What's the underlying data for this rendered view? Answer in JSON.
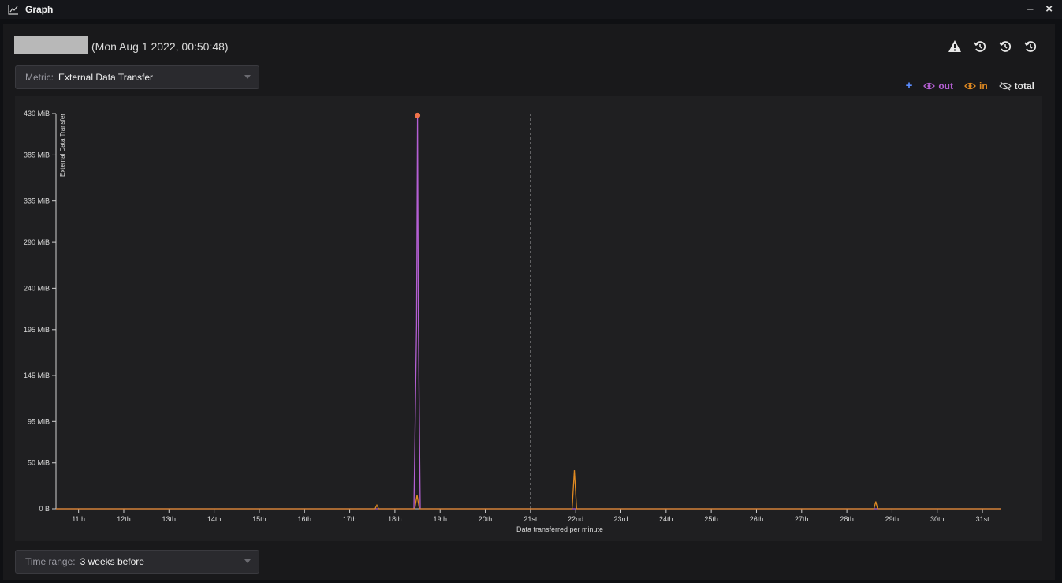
{
  "window": {
    "title": "Graph",
    "minimize_label": "–",
    "close_label": "×"
  },
  "header": {
    "timestamp": "(Mon Aug 1 2022, 00:50:48)"
  },
  "metric_select": {
    "label": "Metric:",
    "value": "External Data Transfer"
  },
  "time_range_select": {
    "label": "Time range:",
    "value": "3 weeks before"
  },
  "legend": {
    "add_label": "+",
    "items": [
      {
        "label": "out",
        "color": "#b45fd3",
        "icon": "eye-icon"
      },
      {
        "label": "in",
        "color": "#e08a22",
        "icon": "eye-icon"
      },
      {
        "label": "total",
        "color": "#e6e6e6",
        "icon": "eye-off-icon"
      }
    ]
  },
  "colors": {
    "out": "#b45fd3",
    "in": "#e08a22",
    "peak_marker": "#f0724a",
    "axis": "#cfcfcf"
  },
  "chart_data": {
    "type": "line",
    "xlabel": "Data transferred per minute",
    "ylabel": "External Data Transfer",
    "x_ticks": [
      "11th",
      "12th",
      "13th",
      "14th",
      "15th",
      "16th",
      "17th",
      "18th",
      "19th",
      "20th",
      "21st",
      "22nd",
      "23rd",
      "24th",
      "25th",
      "26th",
      "27th",
      "28th",
      "29th",
      "30th",
      "31st"
    ],
    "x_range": [
      10.5,
      31.4
    ],
    "y_ticks": [
      "0 B",
      "50 MiB",
      "95 MiB",
      "145 MiB",
      "195 MiB",
      "240 MiB",
      "290 MiB",
      "335 MiB",
      "385 MiB",
      "430 MiB"
    ],
    "y_tick_values": [
      0,
      50,
      95,
      145,
      195,
      240,
      290,
      335,
      385,
      430
    ],
    "ylim": [
      0,
      430
    ],
    "vline_x": 21.0,
    "series": [
      {
        "name": "out",
        "color": "#b45fd3",
        "points": [
          [
            10.5,
            0
          ],
          [
            18.42,
            0
          ],
          [
            18.48,
            200
          ],
          [
            18.5,
            428
          ],
          [
            18.52,
            200
          ],
          [
            18.56,
            0
          ],
          [
            31.4,
            0
          ]
        ]
      },
      {
        "name": "in",
        "color": "#e08a22",
        "points": [
          [
            10.5,
            0
          ],
          [
            17.56,
            0
          ],
          [
            17.6,
            4
          ],
          [
            17.64,
            0
          ],
          [
            18.44,
            0
          ],
          [
            18.49,
            15
          ],
          [
            18.54,
            0
          ],
          [
            21.92,
            0
          ],
          [
            21.97,
            42
          ],
          [
            22.02,
            0
          ],
          [
            28.6,
            0
          ],
          [
            28.64,
            8
          ],
          [
            28.68,
            0
          ],
          [
            31.4,
            0
          ]
        ]
      }
    ],
    "peak_point": [
      18.5,
      428
    ]
  }
}
